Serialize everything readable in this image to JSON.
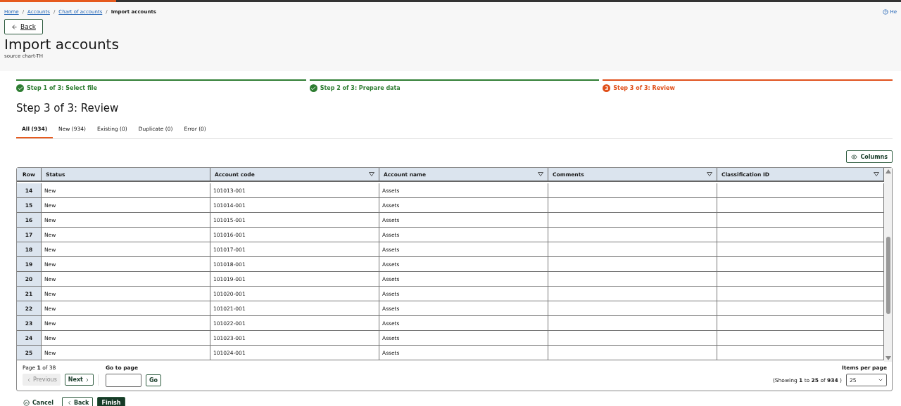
{
  "breadcrumb": [
    {
      "label": "Home",
      "link": true
    },
    {
      "separator": "/",
      "label": "Accounts",
      "link": true
    },
    {
      "separator": "/",
      "label": "Chart of accounts",
      "link": true
    },
    {
      "separator": "/",
      "label": "Import accounts",
      "link": false
    }
  ],
  "help": {
    "label": "He"
  },
  "back_button": {
    "label": "Back"
  },
  "title": "Import accounts",
  "subtitle": "source chart-TH",
  "steps": [
    {
      "label": "Step 1 of 3: Select file",
      "completed": true
    },
    {
      "label": "Step 2 of 3: Prepare data",
      "completed": true
    },
    {
      "label": "Step 3 of 3: Review",
      "completed": false,
      "number": "3"
    }
  ],
  "step_title": "Step 3 of 3: Review",
  "tabs": [
    {
      "label": "All (934)",
      "selected": true
    },
    {
      "label": "New (934)",
      "selected": false
    },
    {
      "label": "Existing (0)",
      "selected": false
    },
    {
      "label": "Duplicate (0)",
      "selected": false
    },
    {
      "label": "Error (0)",
      "selected": false
    }
  ],
  "columns_button": {
    "label": "Columns"
  },
  "table": {
    "columns": [
      {
        "label": "Row",
        "filterable": false
      },
      {
        "label": "Status",
        "filterable": false
      },
      {
        "label": "Account code",
        "filterable": true
      },
      {
        "label": "Account name",
        "filterable": true
      },
      {
        "label": "Comments",
        "filterable": true
      },
      {
        "label": "Classification ID",
        "filterable": true
      }
    ],
    "rows": [
      {
        "row": "14",
        "status": "New",
        "code": "101013-001",
        "name": "Assets"
      },
      {
        "row": "15",
        "status": "New",
        "code": "101014-001",
        "name": "Assets"
      },
      {
        "row": "16",
        "status": "New",
        "code": "101015-001",
        "name": "Assets"
      },
      {
        "row": "17",
        "status": "New",
        "code": "101016-001",
        "name": "Assets"
      },
      {
        "row": "18",
        "status": "New",
        "code": "101017-001",
        "name": "Assets"
      },
      {
        "row": "19",
        "status": "New",
        "code": "101018-001",
        "name": "Assets"
      },
      {
        "row": "20",
        "status": "New",
        "code": "101019-001",
        "name": "Assets"
      },
      {
        "row": "21",
        "status": "New",
        "code": "101020-001",
        "name": "Assets"
      },
      {
        "row": "22",
        "status": "New",
        "code": "101021-001",
        "name": "Assets"
      },
      {
        "row": "23",
        "status": "New",
        "code": "101022-001",
        "name": "Assets"
      },
      {
        "row": "24",
        "status": "New",
        "code": "101023-001",
        "name": "Assets"
      },
      {
        "row": "25",
        "status": "New",
        "code": "101024-001",
        "name": "Assets"
      }
    ]
  },
  "pagination": {
    "page_info": "Page **1** of 38",
    "previous": {
      "label": "Previous",
      "disabled": true
    },
    "next": {
      "label": "Next",
      "disabled": false
    },
    "go_to_label": "Go to page",
    "go_button": "Go",
    "showing": "(Showing **1** to **25** of **934** )",
    "per_page_label": "Items per page",
    "per_page": "25"
  },
  "footer": {
    "cancel": "Cancel",
    "back": "Back",
    "finish": "Finish"
  }
}
